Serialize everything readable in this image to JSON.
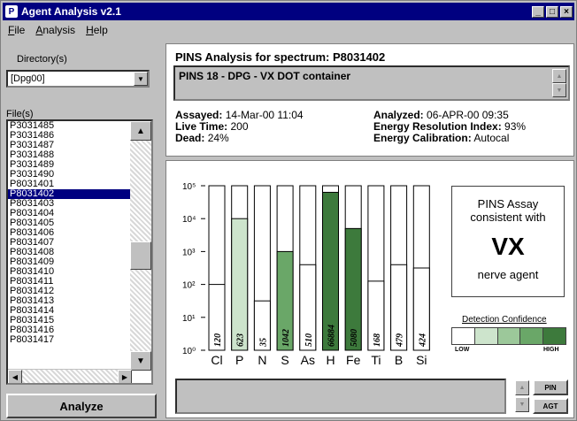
{
  "window": {
    "title": "Agent Analysis v2.1",
    "app_icon": "P"
  },
  "menu": [
    "File",
    "Analysis",
    "Help"
  ],
  "left": {
    "directory_label": "Directory(s)",
    "directory_value": "[Dpg00]",
    "files_label": "File(s)",
    "files": [
      "P3031485",
      "P3031486",
      "P3031487",
      "P3031488",
      "P3031489",
      "P3031490",
      "P8031401",
      "P8031402",
      "P8031403",
      "P8031404",
      "P8031405",
      "P8031406",
      "P8031407",
      "P8031408",
      "P8031409",
      "P8031410",
      "P8031411",
      "P8031412",
      "P8031413",
      "P8031414",
      "P8031415",
      "P8031416",
      "P8031417"
    ],
    "selected_file": "P8031402",
    "analyze_label": "Analyze"
  },
  "header": {
    "title": "PINS Analysis for spectrum:  P8031402",
    "description": "PINS 18 - DPG - VX DOT container"
  },
  "meta": {
    "assayed_label": "Assayed:",
    "assayed_value": "14-Mar-00 11:04",
    "live_time_label": "Live Time:",
    "live_time_value": "200",
    "dead_label": "Dead:",
    "dead_value": "24%",
    "analyzed_label": "Analyzed:",
    "analyzed_value": "06-APR-00 09:35",
    "eri_label": "Energy Resolution Index:",
    "eri_value": "93%",
    "calib_label": "Energy Calibration:",
    "calib_value": "Autocal"
  },
  "verdict": {
    "line1": "PINS Assay",
    "line2": "consistent with",
    "agent": "VX",
    "kind": "nerve agent"
  },
  "confidence": {
    "title": "Detection Confidence",
    "low": "LOW",
    "high": "HIGH",
    "colors": [
      "#ffffff",
      "#cde4cc",
      "#9cc89a",
      "#6aa768",
      "#3d7a3c"
    ]
  },
  "buttons": {
    "pin": "PIN",
    "agt": "AGT"
  },
  "chart_data": {
    "type": "bar",
    "scale": "log",
    "ylim": [
      1,
      100000
    ],
    "ytick_labels": [
      "10⁰",
      "10¹",
      "10²",
      "10³",
      "10⁴",
      "10⁵"
    ],
    "categories": [
      "Cl",
      "P",
      "N",
      "S",
      "As",
      "H",
      "Fe",
      "Ti",
      "B",
      "Si"
    ],
    "values": [
      120,
      623,
      35,
      1042,
      510,
      66884,
      5080,
      168,
      479,
      424
    ],
    "fill_levels": [
      2,
      4,
      1.5,
      3,
      2.6,
      4.8,
      3.7,
      2.1,
      2.6,
      2.5
    ],
    "fill_colors": [
      "#ffffff",
      "#cde4cc",
      "#ffffff",
      "#6aa768",
      "#ffffff",
      "#3d7a3c",
      "#3d7a3c",
      "#ffffff",
      "#ffffff",
      "#ffffff"
    ]
  }
}
